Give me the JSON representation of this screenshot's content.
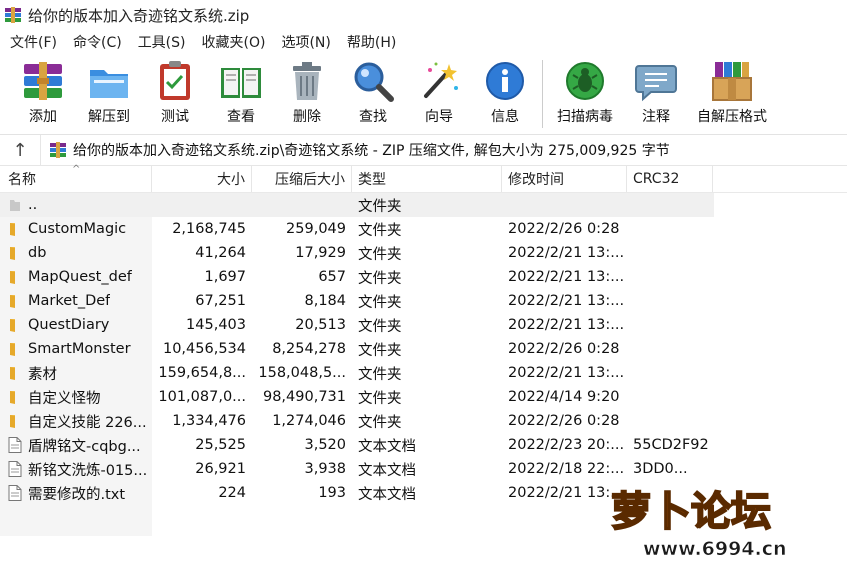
{
  "window": {
    "title": "给你的版本加入奇迹铭文系统.zip"
  },
  "menu": [
    "文件(F)",
    "命令(C)",
    "工具(S)",
    "收藏夹(O)",
    "选项(N)",
    "帮助(H)"
  ],
  "toolbar": [
    {
      "label": "添加",
      "icon": "add-archive-icon"
    },
    {
      "label": "解压到",
      "icon": "extract-folder-icon"
    },
    {
      "label": "测试",
      "icon": "test-clipboard-icon"
    },
    {
      "label": "查看",
      "icon": "view-book-icon"
    },
    {
      "label": "删除",
      "icon": "trash-icon"
    },
    {
      "label": "查找",
      "icon": "find-magnifier-icon"
    },
    {
      "label": "向导",
      "icon": "wizard-wand-icon"
    },
    {
      "label": "信息",
      "icon": "info-icon"
    },
    {
      "label": "扫描病毒",
      "icon": "virus-scan-icon"
    },
    {
      "label": "注释",
      "icon": "comment-icon"
    },
    {
      "label": "自解压格式",
      "icon": "sfx-box-icon"
    }
  ],
  "address": {
    "text": "给你的版本加入奇迹铭文系统.zip\\奇迹铭文系统 - ZIP 压缩文件, 解包大小为 275,009,925 字节"
  },
  "columns": {
    "name": "名称",
    "size": "大小",
    "packed": "压缩后大小",
    "type": "类型",
    "modified": "修改时间",
    "crc": "CRC32"
  },
  "rows": [
    {
      "kind": "parent",
      "name": "..",
      "size": "",
      "packed": "",
      "type": "文件夹",
      "modified": "",
      "crc": ""
    },
    {
      "kind": "folder",
      "name": "CustomMagic",
      "size": "2,168,745",
      "packed": "259,049",
      "type": "文件夹",
      "modified": "2022/2/26 0:28",
      "crc": ""
    },
    {
      "kind": "folder",
      "name": "db",
      "size": "41,264",
      "packed": "17,929",
      "type": "文件夹",
      "modified": "2022/2/21 13:...",
      "crc": ""
    },
    {
      "kind": "folder",
      "name": "MapQuest_def",
      "size": "1,697",
      "packed": "657",
      "type": "文件夹",
      "modified": "2022/2/21 13:...",
      "crc": ""
    },
    {
      "kind": "folder",
      "name": "Market_Def",
      "size": "67,251",
      "packed": "8,184",
      "type": "文件夹",
      "modified": "2022/2/21 13:...",
      "crc": ""
    },
    {
      "kind": "folder",
      "name": "QuestDiary",
      "size": "145,403",
      "packed": "20,513",
      "type": "文件夹",
      "modified": "2022/2/21 13:...",
      "crc": ""
    },
    {
      "kind": "folder",
      "name": "SmartMonster",
      "size": "10,456,534",
      "packed": "8,254,278",
      "type": "文件夹",
      "modified": "2022/2/26 0:28",
      "crc": ""
    },
    {
      "kind": "folder",
      "name": "素材",
      "size": "159,654,8...",
      "packed": "158,048,5...",
      "type": "文件夹",
      "modified": "2022/2/21 13:...",
      "crc": ""
    },
    {
      "kind": "folder",
      "name": "自定义怪物",
      "size": "101,087,0...",
      "packed": "98,490,731",
      "type": "文件夹",
      "modified": "2022/4/14 9:20",
      "crc": ""
    },
    {
      "kind": "folder",
      "name": "自定义技能 226...",
      "size": "1,334,476",
      "packed": "1,274,046",
      "type": "文件夹",
      "modified": "2022/2/26 0:28",
      "crc": ""
    },
    {
      "kind": "file",
      "name": "盾牌铭文-cqbg...",
      "size": "25,525",
      "packed": "3,520",
      "type": "文本文档",
      "modified": "2022/2/23 20:...",
      "crc": "55CD2F92"
    },
    {
      "kind": "file",
      "name": "新铭文洗炼-015...",
      "size": "26,921",
      "packed": "3,938",
      "type": "文本文档",
      "modified": "2022/2/18 22:...",
      "crc": "3DD0..."
    },
    {
      "kind": "file",
      "name": "需要修改的.txt",
      "size": "224",
      "packed": "193",
      "type": "文本文档",
      "modified": "2022/2/21 13:...",
      "crc": ""
    }
  ],
  "watermark": {
    "brand": "萝卜论坛",
    "url": "www.6994.cn"
  },
  "colors": {
    "folder": "#f2c14e",
    "watermark_orange": "#f07b12",
    "watermark_green": "#1a9a3a"
  }
}
